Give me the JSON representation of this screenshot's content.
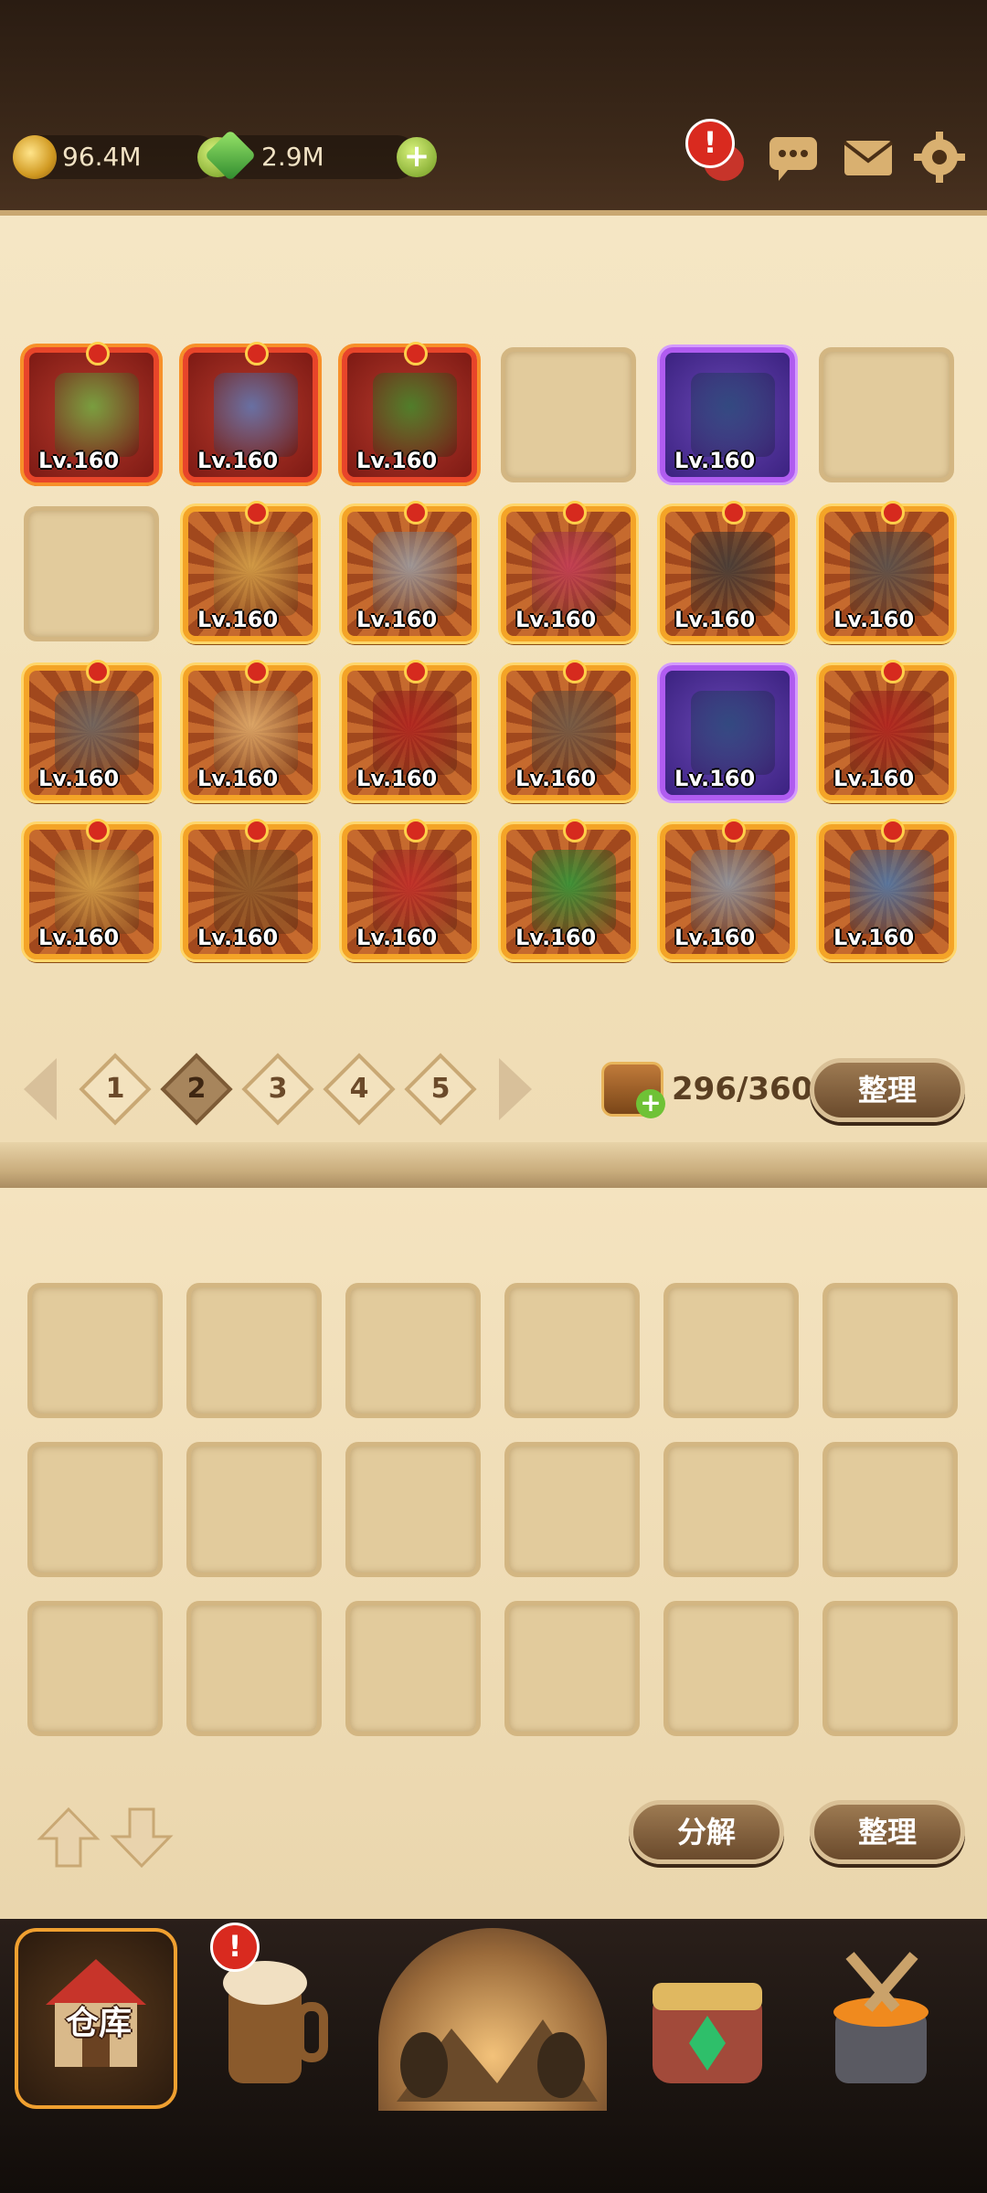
{
  "currency": {
    "gold": "96.4M",
    "gems": "2.9M"
  },
  "inventory": {
    "items": [
      {
        "type": "red",
        "level": "Lv.160"
      },
      {
        "type": "red",
        "level": "Lv.160"
      },
      {
        "type": "red",
        "level": "Lv.160"
      },
      {
        "type": "empty",
        "level": ""
      },
      {
        "type": "purple",
        "level": "Lv.160"
      },
      {
        "type": "empty",
        "level": ""
      },
      {
        "type": "empty",
        "level": ""
      },
      {
        "type": "gold",
        "level": "Lv.160"
      },
      {
        "type": "gold",
        "level": "Lv.160"
      },
      {
        "type": "gold",
        "level": "Lv.160"
      },
      {
        "type": "gold",
        "level": "Lv.160"
      },
      {
        "type": "gold",
        "level": "Lv.160"
      },
      {
        "type": "gold",
        "level": "Lv.160"
      },
      {
        "type": "gold",
        "level": "Lv.160"
      },
      {
        "type": "gold",
        "level": "Lv.160"
      },
      {
        "type": "gold",
        "level": "Lv.160"
      },
      {
        "type": "purple",
        "level": "Lv.160"
      },
      {
        "type": "gold",
        "level": "Lv.160"
      },
      {
        "type": "gold",
        "level": "Lv.160"
      },
      {
        "type": "gold",
        "level": "Lv.160"
      },
      {
        "type": "gold",
        "level": "Lv.160"
      },
      {
        "type": "gold",
        "level": "Lv.160"
      },
      {
        "type": "gold",
        "level": "Lv.160"
      },
      {
        "type": "gold",
        "level": "Lv.160"
      }
    ],
    "pages": [
      "1",
      "2",
      "3",
      "4",
      "5"
    ],
    "active_page": "2",
    "capacity": "296/360",
    "sort_label": "整理"
  },
  "workbench": {
    "slots": 18,
    "disassemble_label": "分解",
    "sort_label": "整理"
  },
  "nav": {
    "warehouse_label": "仓库",
    "alert_mark": "!"
  },
  "icons": [
    "coin-icon",
    "gem-icon",
    "plus-icon",
    "alert-icon",
    "chat-icon",
    "mail-icon",
    "gear-icon",
    "chest-icon",
    "arrow-up-icon",
    "arrow-down-icon",
    "warehouse-icon",
    "tavern-icon",
    "portal-icon",
    "shop-icon",
    "forge-icon"
  ]
}
